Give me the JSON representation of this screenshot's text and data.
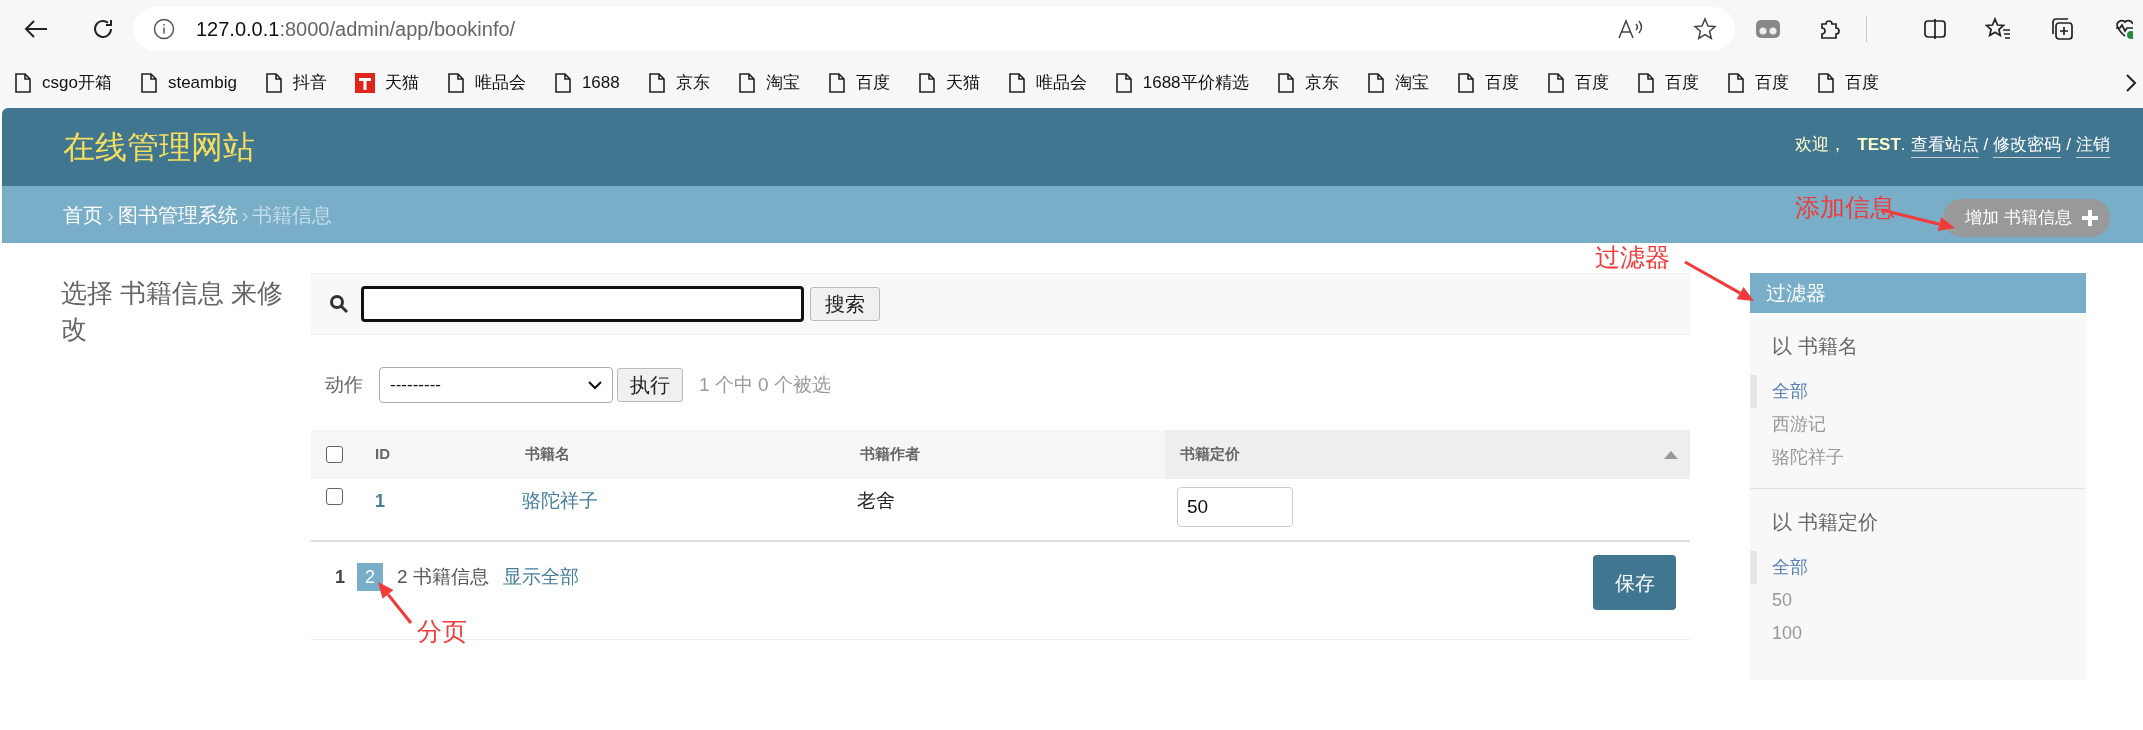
{
  "address_bar": {
    "host": "127.0.0.1",
    "path": ":8000/admin/app/bookinfo/"
  },
  "bookmarks": [
    {
      "label": "csgo开箱",
      "kind": "page"
    },
    {
      "label": "steambig",
      "kind": "page"
    },
    {
      "label": "抖音",
      "kind": "page"
    },
    {
      "label": "天猫",
      "kind": "tmall"
    },
    {
      "label": "唯品会",
      "kind": "page"
    },
    {
      "label": "1688",
      "kind": "page"
    },
    {
      "label": "京东",
      "kind": "page"
    },
    {
      "label": "淘宝",
      "kind": "page"
    },
    {
      "label": "百度",
      "kind": "page"
    },
    {
      "label": "天猫",
      "kind": "page"
    },
    {
      "label": "唯品会",
      "kind": "page"
    },
    {
      "label": "1688平价精选",
      "kind": "page"
    },
    {
      "label": "京东",
      "kind": "page"
    },
    {
      "label": "淘宝",
      "kind": "page"
    },
    {
      "label": "百度",
      "kind": "page"
    },
    {
      "label": "百度",
      "kind": "page"
    },
    {
      "label": "百度",
      "kind": "page"
    },
    {
      "label": "百度",
      "kind": "page"
    },
    {
      "label": "百度",
      "kind": "page"
    }
  ],
  "site": {
    "title": "在线管理网站",
    "greeting": "欢迎，",
    "user": "TEST",
    "user_suffix": ".",
    "links": [
      "查看站点",
      "修改密码",
      "注销"
    ],
    "link_separator": "/"
  },
  "breadcrumbs": [
    {
      "label": "首页",
      "current": false
    },
    {
      "label": "图书管理系统",
      "current": false
    },
    {
      "label": "书籍信息",
      "current": true
    }
  ],
  "breadcrumb_separator": "›",
  "add_button": "增加 书籍信息",
  "page_title": "选择 书籍信息 来修改",
  "search": {
    "focused": true,
    "button": "搜索"
  },
  "actions": {
    "label": "动作",
    "select_value": "---------",
    "run_button": "执行",
    "selection_counter": "1 个中 0 个被选"
  },
  "table": {
    "select_all_checked": false,
    "columns": [
      {
        "label": "ID",
        "sorted": false
      },
      {
        "label": "书籍名",
        "sorted": false
      },
      {
        "label": "书籍作者",
        "sorted": false
      },
      {
        "label": "书籍定价",
        "sorted": true
      }
    ],
    "rows": [
      {
        "checked": false,
        "id": "1",
        "name": "骆陀祥子",
        "author": "老舍",
        "price": "50"
      }
    ]
  },
  "pagination": {
    "pages": [
      {
        "label": "1",
        "selected": true
      },
      {
        "label": "2",
        "selected": false
      }
    ],
    "count": "2 书籍信息",
    "show_all": "显示全部"
  },
  "save_button": "保存",
  "filter": {
    "title": "过滤器",
    "groups": [
      {
        "title": "以 书籍名",
        "options": [
          {
            "label": "全部",
            "selected": true
          },
          {
            "label": "西游记",
            "selected": false
          },
          {
            "label": "骆陀祥子",
            "selected": false
          }
        ]
      },
      {
        "title": "以 书籍定价",
        "options": [
          {
            "label": "全部",
            "selected": true
          },
          {
            "label": "50",
            "selected": false
          },
          {
            "label": "100",
            "selected": false
          }
        ]
      }
    ]
  },
  "annotations": [
    {
      "text": "添加信息"
    },
    {
      "text": "过滤器"
    },
    {
      "text": "分页"
    }
  ]
}
